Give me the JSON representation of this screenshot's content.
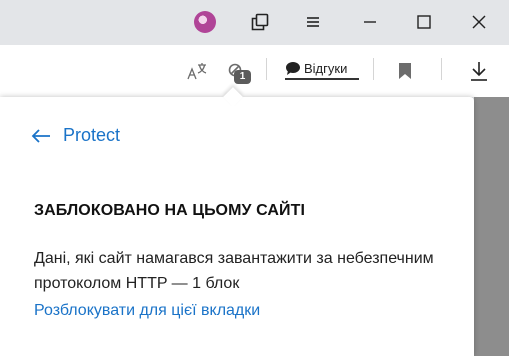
{
  "titlebar": {
    "avatar_icon": "profile-avatar",
    "collections_icon": "collections-icon",
    "menu_icon": "menu-icon",
    "minimize_icon": "minimize-icon",
    "maximize_icon": "maximize-icon",
    "close_icon": "close-icon"
  },
  "toolbar": {
    "translate_icon": "translate-icon",
    "protect_badge": "1",
    "reviews_label": "Відгуки",
    "bookmark_icon": "bookmark-icon",
    "download_icon": "download-icon"
  },
  "popup": {
    "back_label": "Protect",
    "heading": "ЗАБЛОКОВАНО НА ЦЬОМУ САЙТІ",
    "description": "Дані, які сайт намагався завантажити за небезпечним протоколом HTTP — 1 блок",
    "unblock_link": "Розблокувати для цієї вкладки"
  },
  "colors": {
    "link": "#1a73c8",
    "titlebar_bg": "#e3e5e8"
  }
}
